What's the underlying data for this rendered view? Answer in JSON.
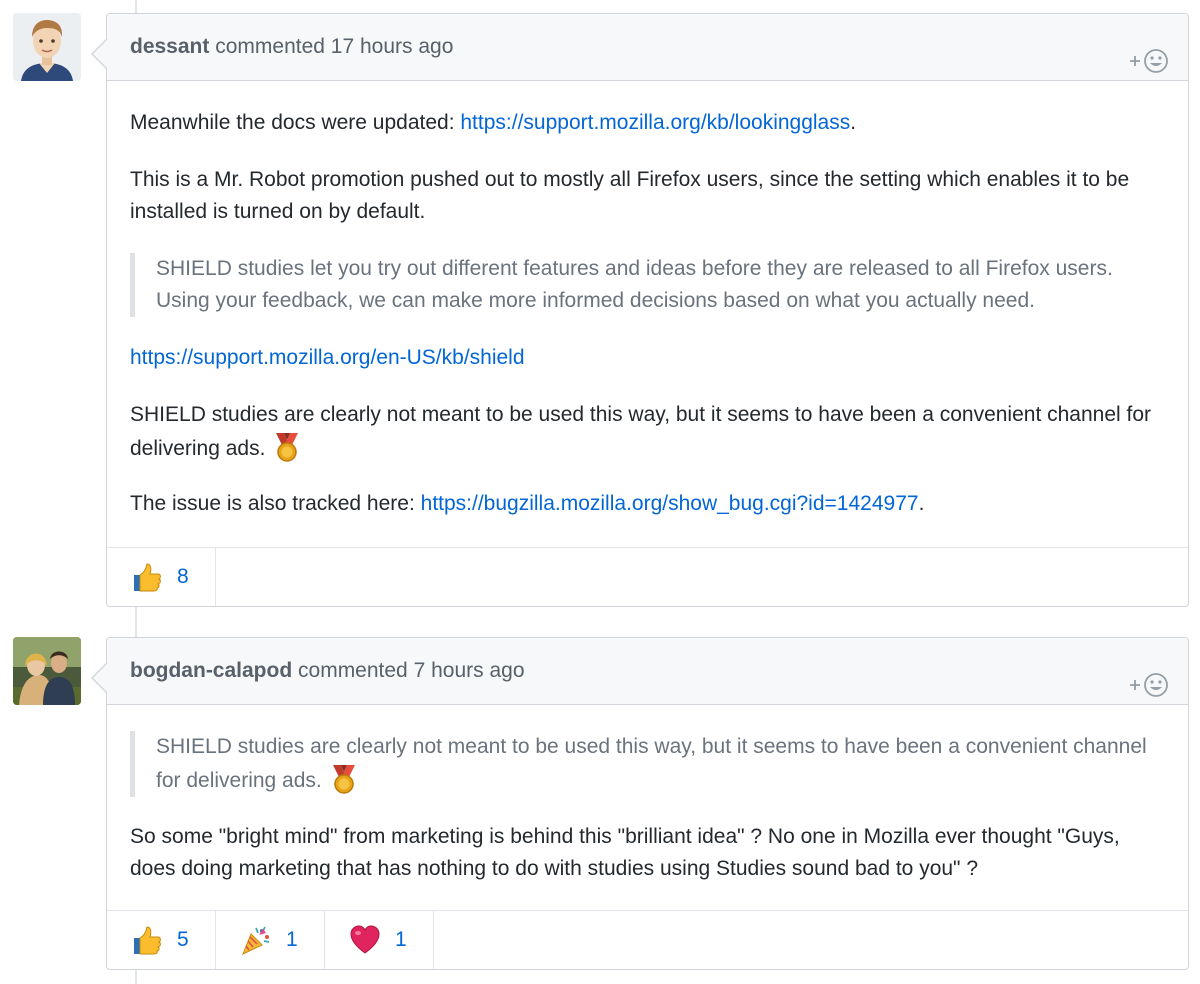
{
  "comments": [
    {
      "author": "dessant",
      "action": "commented",
      "time": "17 hours ago",
      "p1_text": "Meanwhile the docs were updated: ",
      "p1_link": "https://support.mozilla.org/kb/lookingglass",
      "p1_end": ".",
      "p2": "This is a Mr. Robot promotion pushed out to mostly all Firefox users, since the setting which enables it to be installed is turned on by default.",
      "quote": "SHIELD studies let you try out different features and ideas before they are released to all Firefox users. Using your feedback, we can make more informed decisions based on what you actually need.",
      "p3_link": "https://support.mozilla.org/en-US/kb/shield",
      "p4": "SHIELD studies are clearly not meant to be used this way, but it seems to have been a convenient channel for delivering ads.",
      "p4_emoji": "medal",
      "p5_text": "The issue is also tracked here: ",
      "p5_link": "https://bugzilla.mozilla.org/show_bug.cgi?id=1424977",
      "p5_end": ".",
      "reactions": [
        {
          "icon": "thumbs-up-icon",
          "count": "8"
        }
      ]
    },
    {
      "author": "bogdan-calapod",
      "action": "commented",
      "time": "7 hours ago",
      "quote": "SHIELD studies are clearly not meant to be used this way, but it seems to have been a convenient channel for delivering ads.",
      "quote_emoji": "medal",
      "p1": "So some \"bright mind\" from marketing is behind this \"brilliant idea\" ? No one in Mozilla ever thought \"Guys, does doing marketing that has nothing to do with studies using Studies sound bad to you\" ?",
      "reactions": [
        {
          "icon": "thumbs-up-icon",
          "count": "5"
        },
        {
          "icon": "party-popper-icon",
          "count": "1"
        },
        {
          "icon": "heart-icon",
          "count": "1"
        }
      ]
    }
  ],
  "colors": {
    "link": "#0366d6",
    "header_bg": "#f6f8fa",
    "border": "#d1d5da",
    "quote_text": "#6a737d"
  }
}
